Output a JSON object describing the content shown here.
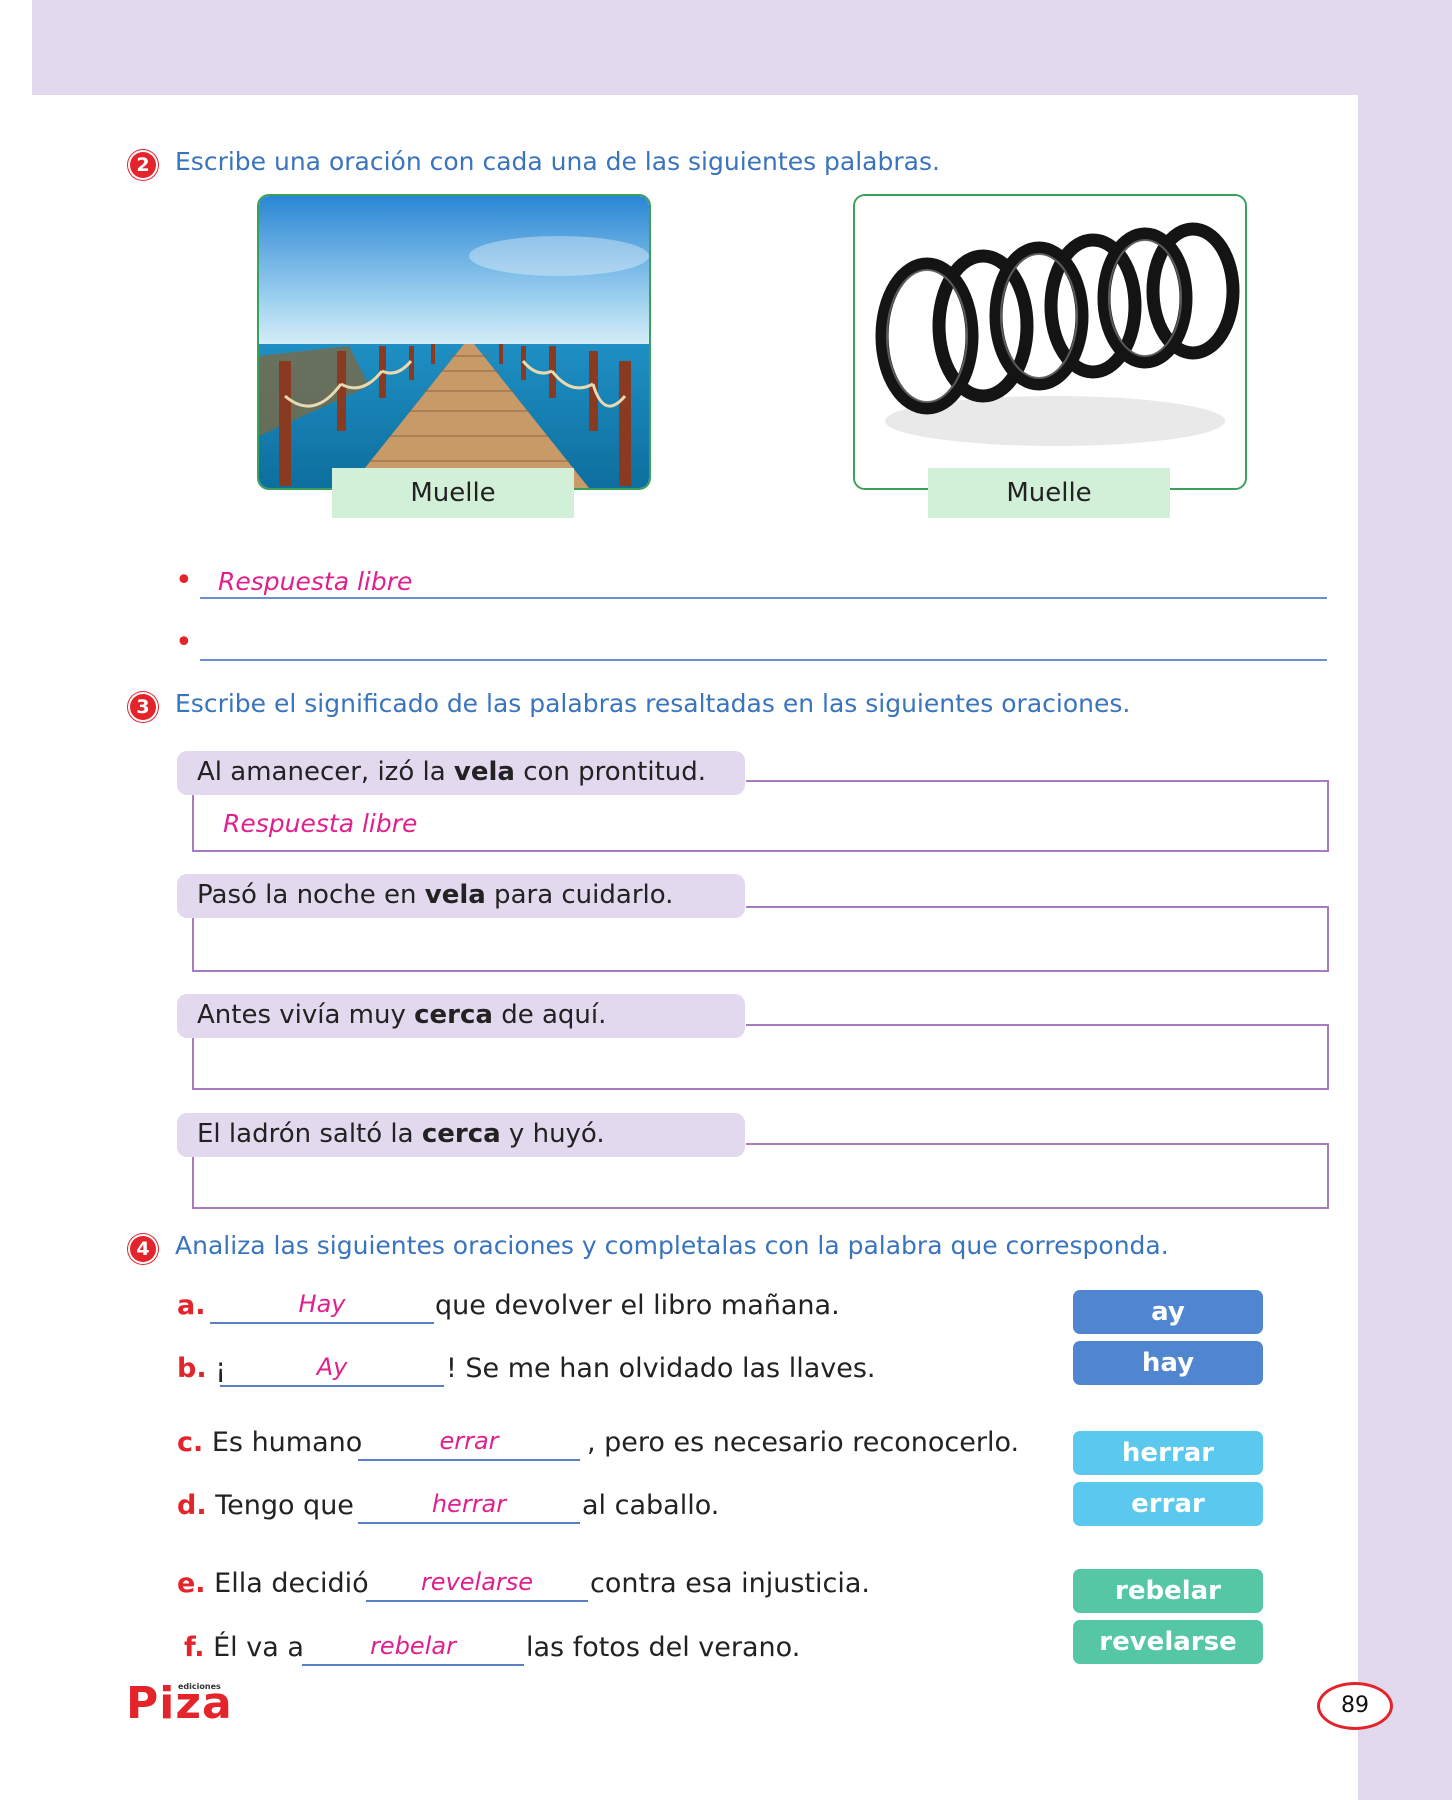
{
  "section2": {
    "number": "2",
    "title": "Escribe una oración con cada una de las siguientes palabras.",
    "images": [
      {
        "caption": "Muelle",
        "depicts": "wooden pier over the sea"
      },
      {
        "caption": "Muelle",
        "depicts": "black metal spring"
      }
    ],
    "answers": [
      "Respuesta libre",
      ""
    ]
  },
  "section3": {
    "number": "3",
    "title": "Escribe el significado de las palabras resaltadas en las siguientes oraciones.",
    "items": [
      {
        "before": "Al amanecer, izó la ",
        "bold": "vela",
        "after": " con prontitud.",
        "answer": "Respuesta libre"
      },
      {
        "before": "Pasó la noche en ",
        "bold": "vela",
        "after": " para cuidarlo.",
        "answer": ""
      },
      {
        "before": "Antes vivía muy ",
        "bold": "cerca",
        "after": " de aquí.",
        "answer": ""
      },
      {
        "before": "El ladrón saltó la ",
        "bold": "cerca",
        "after": " y huyó.",
        "answer": ""
      }
    ]
  },
  "section4": {
    "number": "4",
    "title": "Analiza las siguientes oraciones y completalas con la palabra que corresponda.",
    "sentences": [
      {
        "letter": "a.",
        "before": "",
        "fill": "Hay",
        "after": "que devolver el libro mañana."
      },
      {
        "letter": "b.",
        "before": "¡",
        "fill": "Ay",
        "after": "! Se me han olvidado las llaves."
      },
      {
        "letter": "c.",
        "before": "Es humano",
        "fill": "errar",
        "after": ", pero es necesario reconocerlo."
      },
      {
        "letter": "d.",
        "before": "Tengo que",
        "fill": "herrar",
        "after": "al caballo."
      },
      {
        "letter": "e.",
        "before": "Ella decidió",
        "fill": "revelarse",
        "after": "contra esa injusticia."
      },
      {
        "letter": "f.",
        "before": "Él va a",
        "fill": "rebelar",
        "after": "las fotos del verano."
      }
    ],
    "word_bank": [
      {
        "word": "ay",
        "color": "#4f86cf"
      },
      {
        "word": "hay",
        "color": "#4f86cf"
      },
      {
        "word": "herrar",
        "color": "#5bc8ee"
      },
      {
        "word": "errar",
        "color": "#5bc8ee"
      },
      {
        "word": "rebelar",
        "color": "#56c7a4"
      },
      {
        "word": "revelarse",
        "color": "#56c7a4"
      }
    ]
  },
  "footer": {
    "logo": "Piza",
    "logo_small": "ediciones",
    "page_number": "89"
  }
}
